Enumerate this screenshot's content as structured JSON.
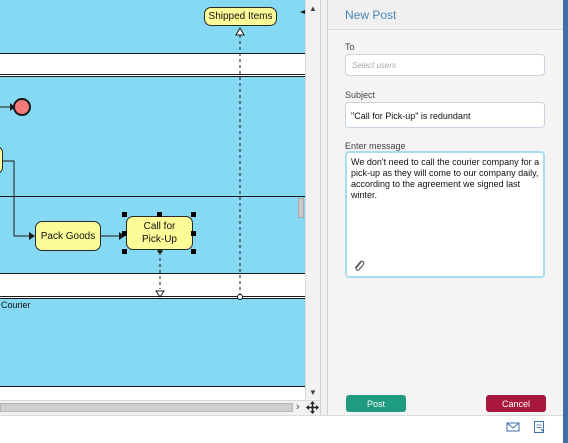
{
  "diagram": {
    "tasks": {
      "shipped_items": "Shipped Items",
      "pack_goods": "Pack Goods",
      "call_for_pickup_line1": "Call for",
      "call_for_pickup_line2": "Pick-Up"
    },
    "lane_label": "Courier"
  },
  "panel": {
    "title": "New Post",
    "to": {
      "label": "To",
      "placeholder": "Select users"
    },
    "subject": {
      "label": "Subject",
      "value": "\"Call for Pick-up\" is redundant"
    },
    "message": {
      "label": "Enter message",
      "value": "We don't need to call the courier company for a pick-up as they will come to our company daily, according to the agreement we signed last winter."
    },
    "post_label": "Post",
    "cancel_label": "Cancel"
  },
  "icons": [
    "attach-icon",
    "mail-icon",
    "note-icon",
    "move-icon"
  ]
}
